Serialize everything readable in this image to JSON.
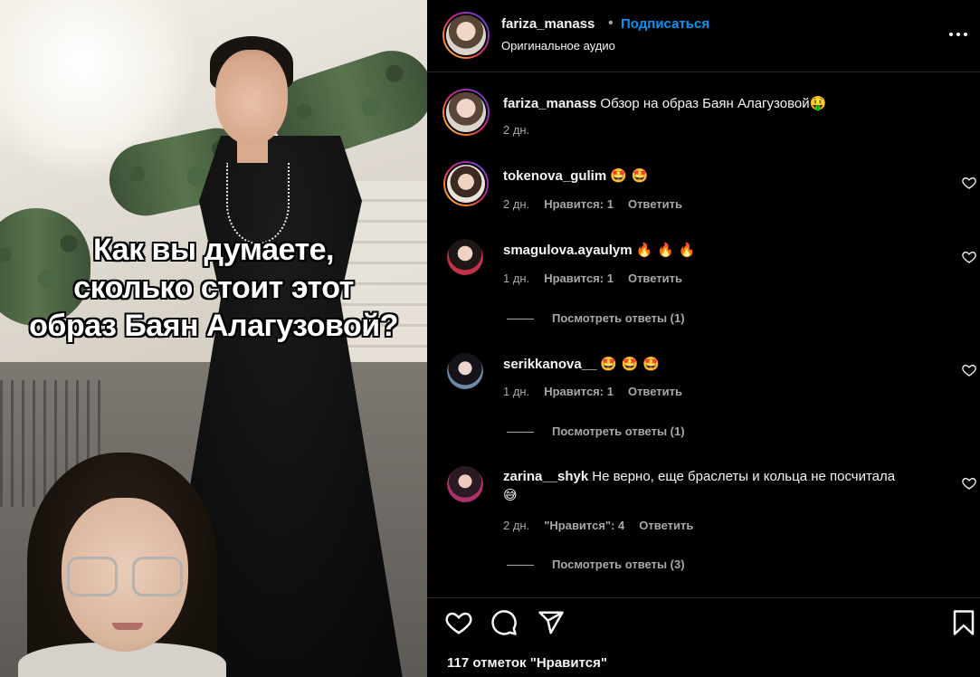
{
  "post": {
    "overlay_lines": [
      "Как вы думаете,",
      "сколько стоит этот",
      "образ Баян Алагузовой?"
    ]
  },
  "header": {
    "username": "fariza_manass",
    "separator": "•",
    "follow_label": "Подписаться",
    "audio": "Оригинальное аудио",
    "more_icon": "more-horizontal-icon"
  },
  "caption": {
    "username": "fariza_manass",
    "text": "Обзор на образ Баян Алагузовой",
    "emoji": "🤑",
    "time": "2 дн."
  },
  "comments": [
    {
      "username": "tokenova_gulim",
      "text": "🤩 🤩",
      "time": "2 дн.",
      "likes": "Нравится: 1",
      "reply": "Ответить",
      "view_replies": ""
    },
    {
      "username": "smagulova.ayaulym",
      "text": "🔥 🔥 🔥",
      "time": "1 дн.",
      "likes": "Нравится: 1",
      "reply": "Ответить",
      "view_replies": "Посмотреть ответы (1)"
    },
    {
      "username": "serikkanova__",
      "text": "🤩 🤩 🤩",
      "time": "1 дн.",
      "likes": "Нравится: 1",
      "reply": "Ответить",
      "view_replies": "Посмотреть ответы (1)"
    },
    {
      "username": "zarina__shyk",
      "text": "Не верно, еще браслеты и кольца не посчитала",
      "emoji": "😅",
      "time": "2 дн.",
      "likes": "\"Нравится\": 4",
      "reply": "Ответить",
      "view_replies": "Посмотреть ответы (3)"
    }
  ],
  "footer": {
    "likes": "117 отметок \"Нравится\"",
    "icons": [
      "heart-icon",
      "comment-icon",
      "share-icon",
      "bookmark-icon"
    ]
  },
  "colors": {
    "background": "#000000",
    "text": "#f5f5f5",
    "muted": "#a8a8a8",
    "link": "#0095f6",
    "divider": "#262626"
  }
}
